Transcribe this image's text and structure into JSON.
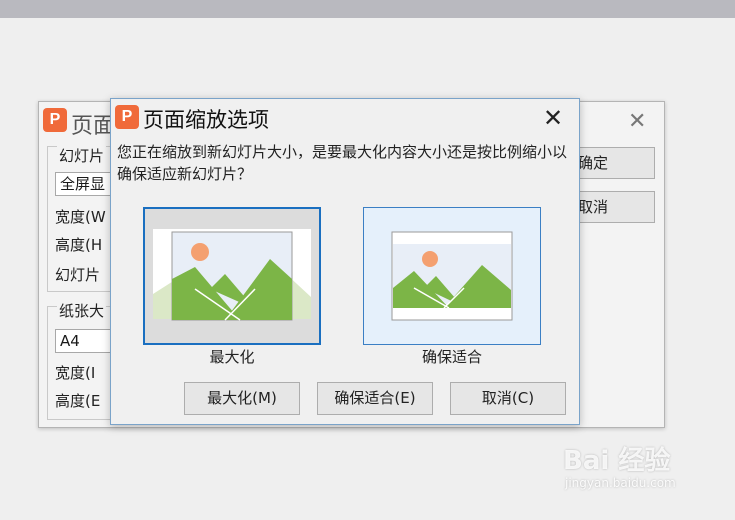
{
  "background_dialog": {
    "title": "页面",
    "slide_size_group_label": "幻灯片",
    "slide_size_value": "全屏显",
    "width_label": "宽度(W",
    "height_label": "高度(H",
    "slides_label": "幻灯片",
    "paper_group_label": "纸张大",
    "paper_value": "A4",
    "paper_width_label": "宽度(I",
    "paper_height_label": "高度(E",
    "ok_label": "确定",
    "cancel_label": "取消"
  },
  "scale_dialog": {
    "title": "页面缩放选项",
    "question": "您正在缩放到新幻灯片大小，是要最大化内容大小还是按比例缩小以确保适应新幻灯片？",
    "options": [
      {
        "caption": "最大化",
        "selected": true
      },
      {
        "caption": "确保适合",
        "selected": false
      }
    ],
    "buttons": {
      "maximize": "最大化(M)",
      "ensure_fit": "确保适合(E)",
      "cancel": "取消(C)"
    }
  },
  "watermark": {
    "brand": "Bai 经验",
    "url": "jingyan.baidu.com"
  },
  "colors": {
    "accent": "#f06a3a",
    "selection_border": "#1a6fc0",
    "mountain_green": "#7cb547",
    "sun_orange": "#f4a070",
    "sky": "#e8eef7"
  }
}
